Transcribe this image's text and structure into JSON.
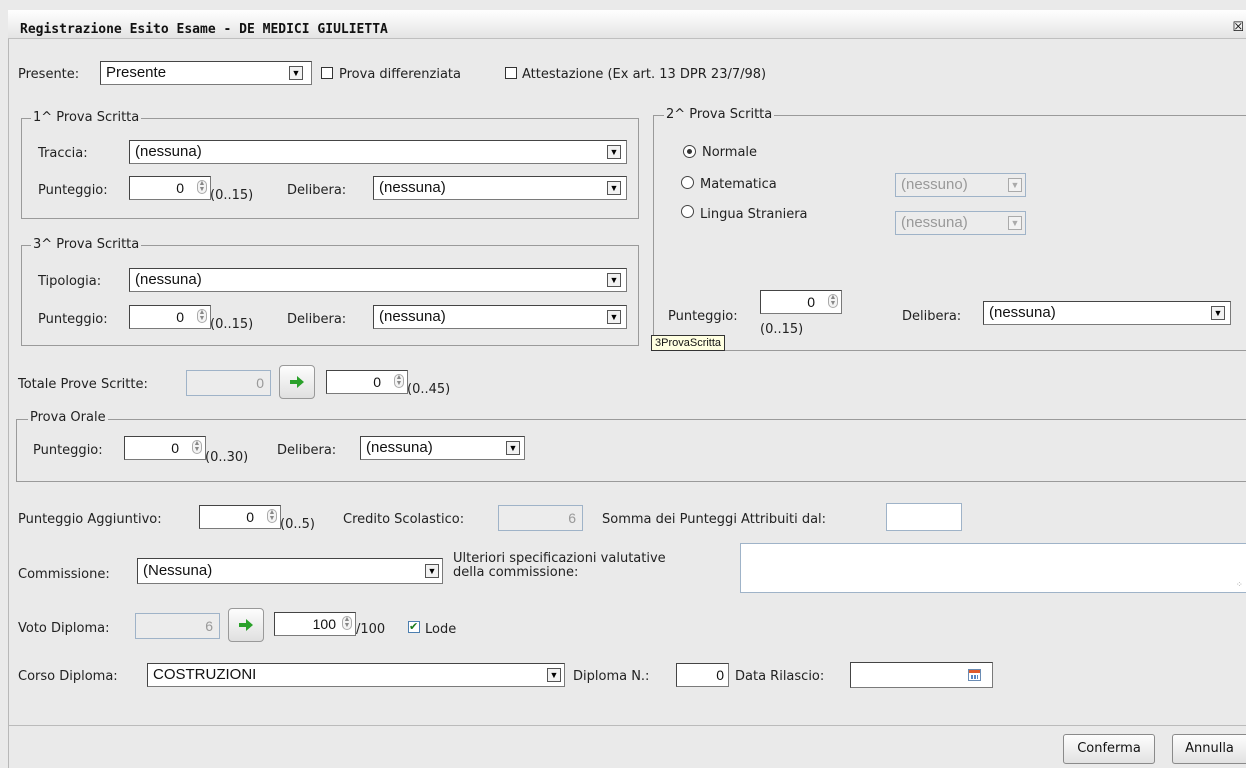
{
  "window": {
    "title": "Registrazione Esito Esame - DE MEDICI GIULIETTA",
    "close_icon": "close-icon"
  },
  "presente": {
    "label": "Presente:",
    "value": "Presente"
  },
  "prova_differenziata": {
    "label": "Prova differenziata",
    "checked": false
  },
  "attestazione": {
    "label": "Attestazione (Ex art. 13 DPR 23/7/98)",
    "checked": false
  },
  "prova1": {
    "legend": "1^ Prova Scritta",
    "traccia_label": "Traccia:",
    "traccia_value": "(nessuna)",
    "punteggio_label": "Punteggio:",
    "punteggio_value": "0",
    "range": "(0..15)",
    "delibera_label": "Delibera:",
    "delibera_value": "(nessuna)"
  },
  "prova2": {
    "legend": "2^ Prova Scritta",
    "options": [
      "Normale",
      "Matematica",
      "Lingua Straniera"
    ],
    "selected": "Normale",
    "matematica_value": "(nessuno)",
    "lingua_value": "(nessuna)",
    "punteggio_label": "Punteggio:",
    "punteggio_value": "0",
    "range": "(0..15)",
    "delibera_label": "Delibera:",
    "delibera_value": "(nessuna)"
  },
  "prova3": {
    "legend": "3^ Prova Scritta",
    "tipologia_label": "Tipologia:",
    "tipologia_value": "(nessuna)",
    "punteggio_label": "Punteggio:",
    "punteggio_value": "0",
    "range": "(0..15)",
    "delibera_label": "Delibera:",
    "delibera_value": "(nessuna)"
  },
  "tooltip": "3ProvaScritta",
  "totale": {
    "label": "Totale Prove Scritte:",
    "computed_value": "0",
    "value": "0",
    "range": "(0..45)"
  },
  "orale": {
    "legend": "Prova Orale",
    "punteggio_label": "Punteggio:",
    "punteggio_value": "0",
    "range": "(0..30)",
    "delibera_label": "Delibera:",
    "delibera_value": "(nessuna)"
  },
  "aggiuntivo": {
    "label": "Punteggio Aggiuntivo:",
    "value": "0",
    "range": "(0..5)"
  },
  "credito": {
    "label": "Credito Scolastico:",
    "value": "6"
  },
  "somma": {
    "label": "Somma dei Punteggi Attribuiti dal:",
    "value": ""
  },
  "commissione": {
    "label": "Commissione:",
    "value": "(Nessuna)"
  },
  "ulteriori": {
    "label_line1": "Ulteriori specificazioni valutative",
    "label_line2": "della commissione:",
    "value": ""
  },
  "voto": {
    "label": "Voto Diploma:",
    "computed_value": "6",
    "value": "100",
    "suffix": "/100",
    "lode_label": "Lode",
    "lode_checked": true
  },
  "corso": {
    "label": "Corso Diploma:",
    "value": "COSTRUZIONI"
  },
  "diploma_n": {
    "label": "Diploma N.:",
    "value": "0"
  },
  "data_rilascio": {
    "label": "Data Rilascio:",
    "value": ""
  },
  "buttons": {
    "confirm": "Conferma",
    "cancel": "Annulla"
  }
}
